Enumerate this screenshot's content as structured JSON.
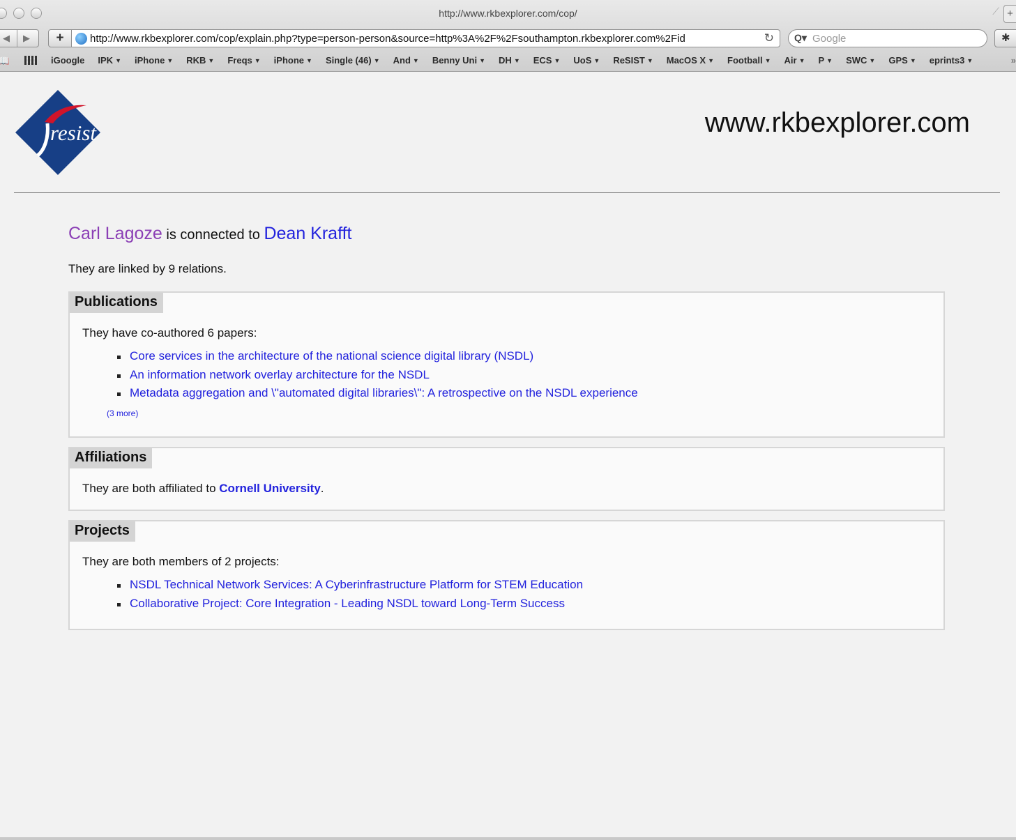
{
  "window": {
    "title": "http://www.rkbexplorer.com/cop/"
  },
  "toolbar": {
    "add_label": "+",
    "url": "http://www.rkbexplorer.com/cop/explain.php?type=person-person&source=http%3A%2F%2Fsouthampton.rkbexplorer.com%2Fid",
    "search_placeholder": "Google"
  },
  "bookmarks": [
    {
      "label": "iGoogle",
      "menu": false
    },
    {
      "label": "IPK",
      "menu": true
    },
    {
      "label": "iPhone",
      "menu": true
    },
    {
      "label": "RKB",
      "menu": true
    },
    {
      "label": "Freqs",
      "menu": true
    },
    {
      "label": "iPhone",
      "menu": true
    },
    {
      "label": "Single (46)",
      "menu": true
    },
    {
      "label": "And",
      "menu": true
    },
    {
      "label": "Benny Uni",
      "menu": true
    },
    {
      "label": "DH",
      "menu": true
    },
    {
      "label": "ECS",
      "menu": true
    },
    {
      "label": "UoS",
      "menu": true
    },
    {
      "label": "ReSIST",
      "menu": true
    },
    {
      "label": "MacOS X",
      "menu": true
    },
    {
      "label": "Football",
      "menu": true
    },
    {
      "label": "Air",
      "menu": true
    },
    {
      "label": "P",
      "menu": true
    },
    {
      "label": "SWC",
      "menu": true
    },
    {
      "label": "GPS",
      "menu": true
    },
    {
      "label": "eprints3",
      "menu": true
    }
  ],
  "page": {
    "logo_text": "resist",
    "site_title": "www.rkbexplorer.com",
    "person1": "Carl Lagoze",
    "connector": "is connected to",
    "person2": "Dean Krafft",
    "relations_text": "They are linked by 9 relations.",
    "publications": {
      "heading": "Publications",
      "intro": "They have co-authored 6 papers:",
      "papers": [
        "Core services in the architecture of the national science digital library (NSDL)",
        "An information network overlay architecture for the NSDL",
        "Metadata aggregation and \\\"automated digital libraries\\\": A retrospective on the NSDL experience"
      ],
      "more_label": "(3 more)"
    },
    "affiliations": {
      "heading": "Affiliations",
      "prefix": "They are both affiliated to",
      "org": "Cornell University",
      "suffix": "."
    },
    "projects": {
      "heading": "Projects",
      "intro": "They are both members of 2 projects:",
      "items": [
        "NSDL Technical Network Services: A Cyberinfrastructure Platform for STEM Education",
        "Collaborative Project: Core Integration - Leading NSDL toward Long-Term Success"
      ]
    }
  },
  "colors": {
    "person1": "#8b3fb5",
    "link": "#2222dd",
    "logo_blue": "#173f86",
    "logo_red": "#d0142a"
  }
}
